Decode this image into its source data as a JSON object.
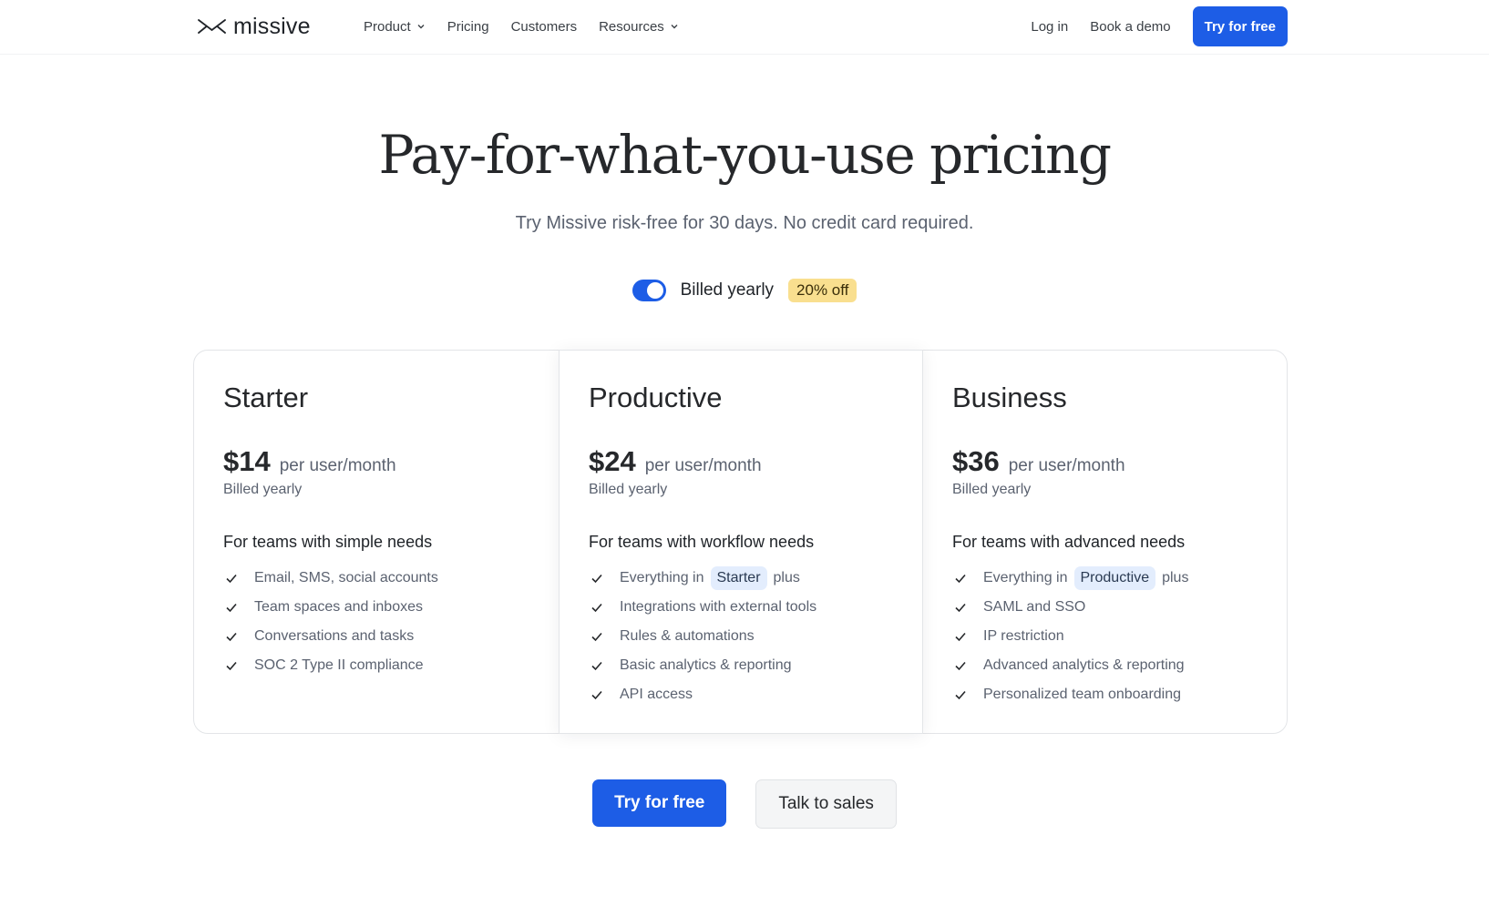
{
  "nav": {
    "logo_text": "missive",
    "links": [
      {
        "label": "Product",
        "has_dropdown": true
      },
      {
        "label": "Pricing",
        "has_dropdown": false
      },
      {
        "label": "Customers",
        "has_dropdown": false
      },
      {
        "label": "Resources",
        "has_dropdown": true
      }
    ],
    "login": "Log in",
    "demo": "Book a demo",
    "try_free": "Try for free"
  },
  "hero": {
    "title": "Pay-for-what-you-use pricing",
    "subtitle": "Try Missive risk-free for 30 days. No credit card required."
  },
  "billing": {
    "toggle_on": true,
    "label": "Billed yearly",
    "discount": "20% off"
  },
  "plans": [
    {
      "name": "Starter",
      "price": "$14",
      "per": "per user/month",
      "billed": "Billed yearly",
      "tagline": "For teams with simple needs",
      "features": [
        {
          "text": "Email, SMS, social accounts"
        },
        {
          "text": "Team spaces and inboxes"
        },
        {
          "text": "Conversations and tasks"
        },
        {
          "text": "SOC 2 Type II compliance"
        }
      ]
    },
    {
      "name": "Productive",
      "price": "$24",
      "per": "per user/month",
      "billed": "Billed yearly",
      "tagline": "For teams with workflow needs",
      "includes": {
        "prefix": "Everything in",
        "plan": "Starter",
        "suffix": "plus"
      },
      "features": [
        {
          "text": "Integrations with external tools"
        },
        {
          "text": "Rules & automations"
        },
        {
          "text": "Basic analytics & reporting"
        },
        {
          "text": "API access"
        }
      ]
    },
    {
      "name": "Business",
      "price": "$36",
      "per": "per user/month",
      "billed": "Billed yearly",
      "tagline": "For teams with advanced needs",
      "includes": {
        "prefix": "Everything in",
        "plan": "Productive",
        "suffix": "plus"
      },
      "features": [
        {
          "text": "SAML and SSO"
        },
        {
          "text": "IP restriction"
        },
        {
          "text": "Advanced analytics & reporting"
        },
        {
          "text": "Personalized team onboarding"
        }
      ]
    }
  ],
  "cta": {
    "primary": "Try for free",
    "secondary": "Talk to sales"
  },
  "colors": {
    "brand_blue": "#1d5de6",
    "discount_bg": "#f9df8f",
    "pill_bg": "#e3edfd"
  }
}
